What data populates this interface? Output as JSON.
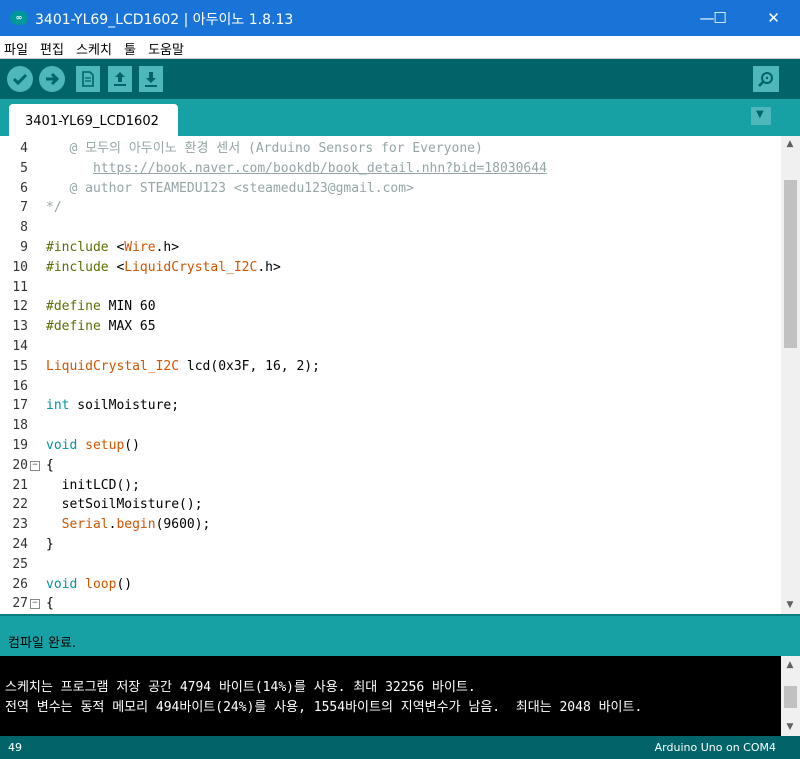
{
  "window": {
    "title": "3401-YL69_LCD1602 | 아두이노 1.8.13",
    "icon_text": "∞",
    "minimize": "—",
    "maximize": "☐",
    "close": "✕"
  },
  "menu": [
    "파일",
    "편집",
    "스케치",
    "툴",
    "도움말"
  ],
  "toolbar": {
    "buttons": [
      "verify-icon",
      "upload-icon",
      "new-icon",
      "open-icon",
      "save-icon"
    ],
    "serial_monitor": "serial-monitor-icon"
  },
  "tabs": [
    {
      "label": "3401-YL69_LCD1602"
    }
  ],
  "tab_menu_icon": "▼",
  "editor": {
    "lines": [
      {
        "num": "4",
        "fold": "",
        "segs": [
          {
            "t": "   @ 모두의 아두이노 환경 센서 (Arduino Sensors for Everyone)",
            "c": "comment"
          }
        ]
      },
      {
        "num": "5",
        "fold": "",
        "segs": [
          {
            "t": "      ",
            "c": "comment"
          },
          {
            "t": "https://book.naver.com/bookdb/book_detail.nhn?bid=18030644",
            "c": "link"
          }
        ]
      },
      {
        "num": "6",
        "fold": "",
        "segs": [
          {
            "t": "   @ author STEAMEDU123 <steamedu123@gmail.com>",
            "c": "comment"
          }
        ]
      },
      {
        "num": "7",
        "fold": "",
        "segs": [
          {
            "t": "*/",
            "c": "comment"
          }
        ]
      },
      {
        "num": "8",
        "fold": "",
        "segs": []
      },
      {
        "num": "9",
        "fold": "",
        "segs": [
          {
            "t": "#include ",
            "c": "pre"
          },
          {
            "t": "<",
            "c": "plain"
          },
          {
            "t": "Wire",
            "c": "lib"
          },
          {
            "t": ".h>",
            "c": "plain"
          }
        ]
      },
      {
        "num": "10",
        "fold": "",
        "segs": [
          {
            "t": "#include ",
            "c": "pre"
          },
          {
            "t": "<",
            "c": "plain"
          },
          {
            "t": "LiquidCrystal_I2C",
            "c": "lib"
          },
          {
            "t": ".h>",
            "c": "plain"
          }
        ]
      },
      {
        "num": "11",
        "fold": "",
        "segs": []
      },
      {
        "num": "12",
        "fold": "",
        "segs": [
          {
            "t": "#define ",
            "c": "pre"
          },
          {
            "t": "MIN 60",
            "c": "plain"
          }
        ]
      },
      {
        "num": "13",
        "fold": "",
        "segs": [
          {
            "t": "#define ",
            "c": "pre"
          },
          {
            "t": "MAX 65",
            "c": "plain"
          }
        ]
      },
      {
        "num": "14",
        "fold": "",
        "segs": []
      },
      {
        "num": "15",
        "fold": "",
        "segs": [
          {
            "t": "LiquidCrystal_I2C",
            "c": "lib"
          },
          {
            "t": " lcd(0x3F, 16, 2);",
            "c": "plain"
          }
        ]
      },
      {
        "num": "16",
        "fold": "",
        "segs": []
      },
      {
        "num": "17",
        "fold": "",
        "segs": [
          {
            "t": "int",
            "c": "kw"
          },
          {
            "t": " soilMoisture;",
            "c": "plain"
          }
        ]
      },
      {
        "num": "18",
        "fold": "",
        "segs": []
      },
      {
        "num": "19",
        "fold": "",
        "segs": [
          {
            "t": "void",
            "c": "kw"
          },
          {
            "t": " ",
            "c": "plain"
          },
          {
            "t": "setup",
            "c": "lib"
          },
          {
            "t": "()",
            "c": "plain"
          }
        ]
      },
      {
        "num": "20",
        "fold": "⊟",
        "segs": [
          {
            "t": "{",
            "c": "plain"
          }
        ]
      },
      {
        "num": "21",
        "fold": "",
        "segs": [
          {
            "t": "  initLCD();",
            "c": "plain"
          }
        ]
      },
      {
        "num": "22",
        "fold": "",
        "segs": [
          {
            "t": "  setSoilMoisture();",
            "c": "plain"
          }
        ]
      },
      {
        "num": "23",
        "fold": "",
        "segs": [
          {
            "t": "  ",
            "c": "plain"
          },
          {
            "t": "Serial",
            "c": "lib"
          },
          {
            "t": ".",
            "c": "plain"
          },
          {
            "t": "begin",
            "c": "lib"
          },
          {
            "t": "(9600);",
            "c": "plain"
          }
        ]
      },
      {
        "num": "24",
        "fold": "",
        "segs": [
          {
            "t": "}",
            "c": "plain"
          }
        ]
      },
      {
        "num": "25",
        "fold": "",
        "segs": []
      },
      {
        "num": "26",
        "fold": "",
        "segs": [
          {
            "t": "void",
            "c": "kw"
          },
          {
            "t": " ",
            "c": "plain"
          },
          {
            "t": "loop",
            "c": "lib"
          },
          {
            "t": "()",
            "c": "plain"
          }
        ]
      },
      {
        "num": "27",
        "fold": "⊟",
        "segs": [
          {
            "t": "{",
            "c": "plain"
          }
        ]
      }
    ]
  },
  "status": "컴파일 완료.",
  "console": [
    "스케치는 프로그램 저장 공간 4794 바이트(14%)를 사용. 최대 32256 바이트.",
    "전역 변수는 동적 메모리 494바이트(24%)를 사용, 1554바이트의 지역변수가 남음.  최대는 2048 바이트."
  ],
  "footer": {
    "line": "49",
    "board": "Arduino Uno on COM4"
  },
  "colors": {
    "titlebar": "#1a74d8",
    "toolbar": "#006468",
    "tabbar": "#17a1a5",
    "button": "#4db7bb",
    "comment": "#95a5a6",
    "keyword": "#00979c",
    "library": "#d35400",
    "preprocessor": "#5e6d03"
  }
}
